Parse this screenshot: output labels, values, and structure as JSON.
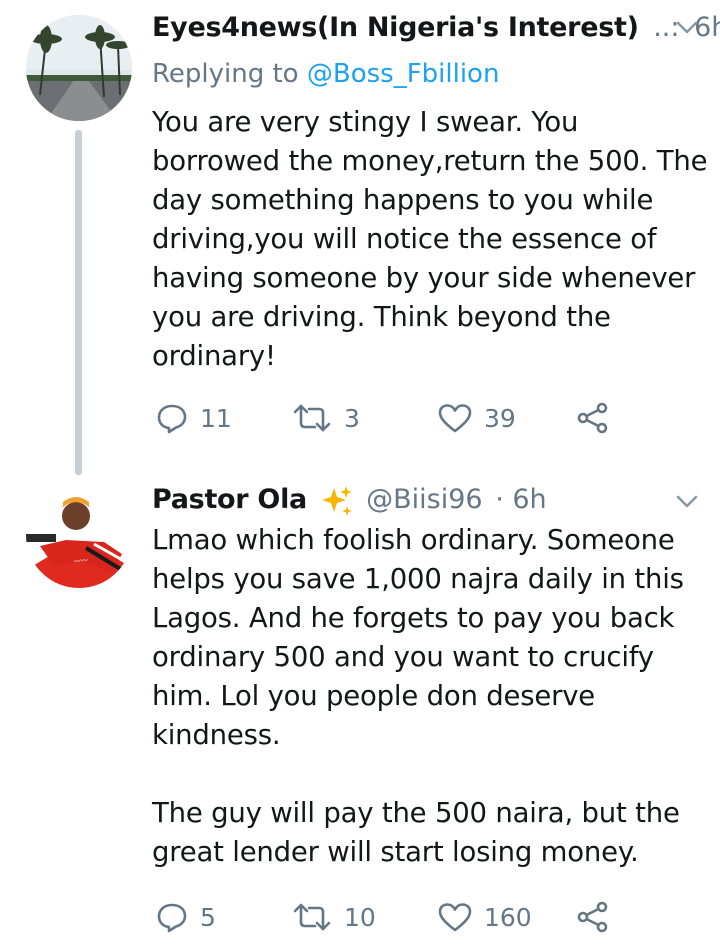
{
  "tweets": [
    {
      "name": "Eyes4news(In Nigeria's Interest)",
      "handle_ellipsis": "..:",
      "time": "6h",
      "replying_prefix": "Replying to",
      "replying_handle": "@Boss_Fbillion",
      "text": "You are very stingy I swear. You\nborrowed the money,return the 500. The\nday something happens to you while\ndriving,you will notice the essence of\nhaving someone by your side whenever\nyou are driving. Think beyond the\nordinary!",
      "replies": "11",
      "retweets": "3",
      "likes": "39",
      "avatar_icon": "palm-tree-road-photo"
    },
    {
      "name": "Pastor Ola",
      "badge_icon": "sparkles-emoji",
      "handle": "@Biisi96",
      "time_sep": "· 6h",
      "text": "Lmao which foolish ordinary. Someone\nhelps you save 1,000 najra daily in this\nLagos. And he forgets to pay you back\nordinary 500 and you want to crucify\nhim. Lol you people don deserve\nkindness.\n\nThe guy will pay the 500 naira, but the\ngreat lender will start losing money.",
      "replies": "5",
      "retweets": "10",
      "likes": "160",
      "avatar_icon": "person-red-outfit-photo"
    }
  ],
  "colors": {
    "text": "#14171a",
    "muted": "#657786",
    "link": "#1da1f2",
    "thread_line": "#c4cfd6"
  }
}
